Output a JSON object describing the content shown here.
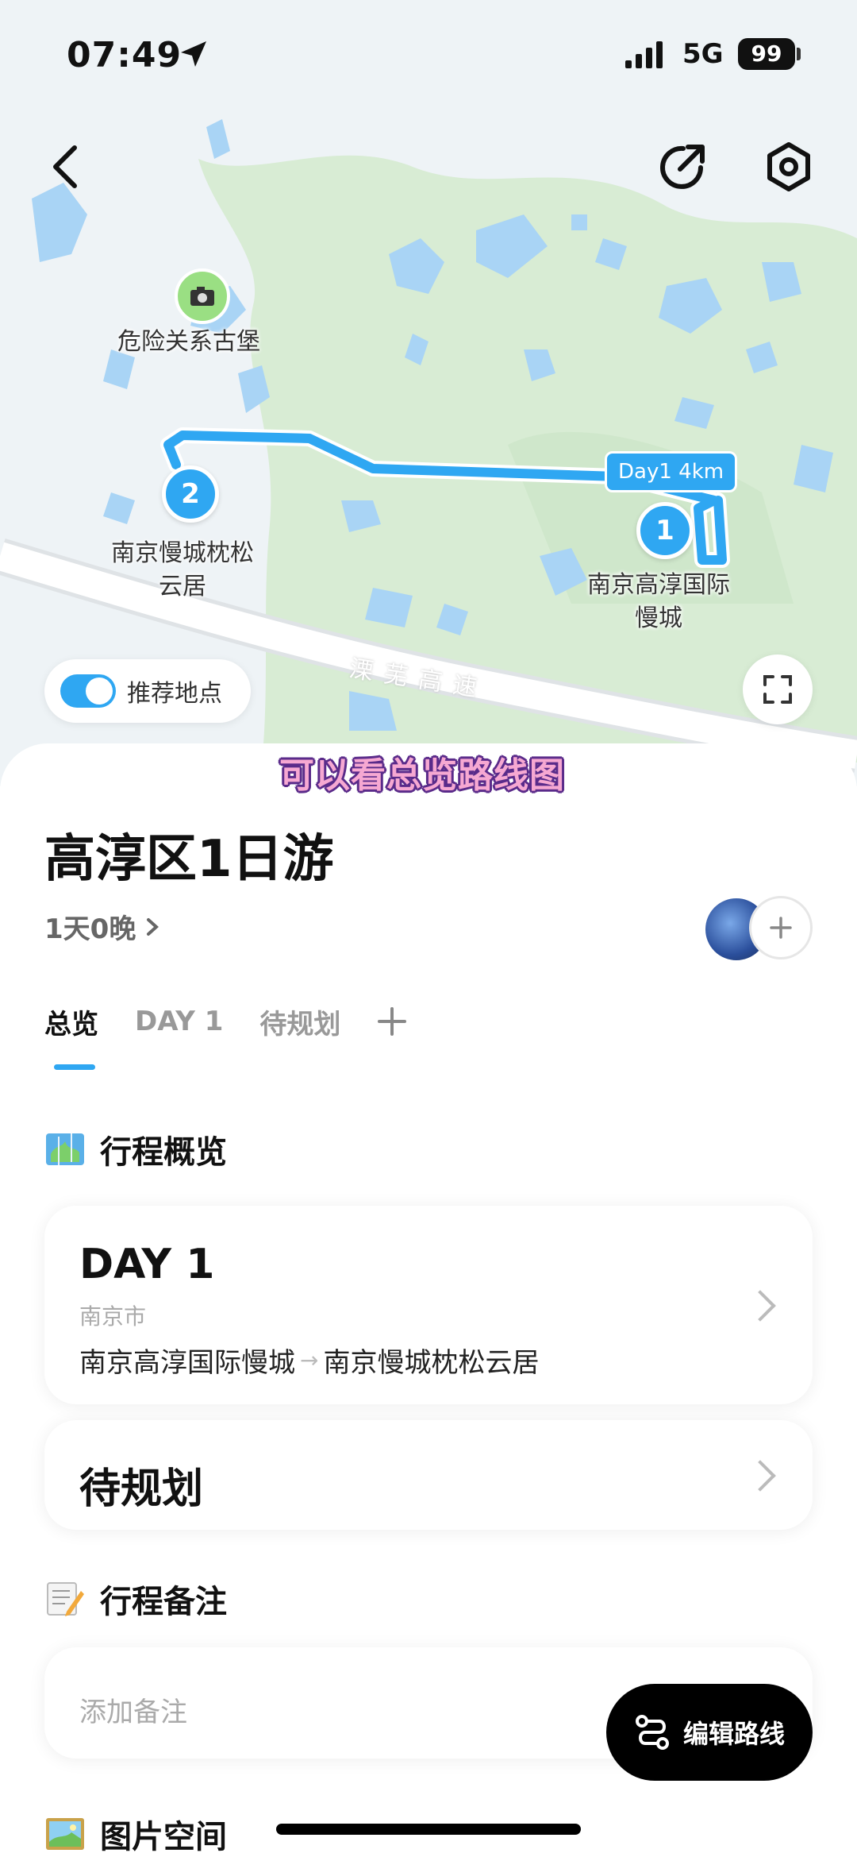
{
  "status_bar": {
    "time": "07:49",
    "network": "5G",
    "battery": "99"
  },
  "map": {
    "poi": {
      "label": "危险关系古堡",
      "icon": "camera-icon"
    },
    "stops": [
      {
        "number": "1",
        "name_line1": "南京高淳国际",
        "name_line2": "慢城"
      },
      {
        "number": "2",
        "name_line1": "南京慢城枕松",
        "name_line2": "云居"
      }
    ],
    "route_badge": "Day1 4km",
    "highway": "溧芜高速",
    "recommend_label": "推荐地点",
    "recommend_enabled": true,
    "colors": {
      "route": "#2fa7f2",
      "green_area": "#d8ecd4",
      "water": "#a9d4f5",
      "road": "#ffffff"
    }
  },
  "caption": "可以看总览路线图",
  "trip": {
    "title": "高淳区1日游",
    "duration": "1天0晚"
  },
  "tabs": [
    {
      "label": "总览",
      "active": true
    },
    {
      "label": "DAY 1",
      "active": false
    },
    {
      "label": "待规划",
      "active": false
    }
  ],
  "sections": {
    "overview": {
      "title": "行程概览",
      "icon": "map-icon"
    },
    "notes": {
      "title": "行程备注",
      "icon": "memo-icon",
      "placeholder": "添加备注"
    },
    "photos": {
      "title": "图片空间",
      "icon": "picture-icon"
    }
  },
  "day_card": {
    "title": "DAY 1",
    "city": "南京市",
    "from": "南京高淳国际慢城",
    "to": "南京慢城枕松云居"
  },
  "pending_card": {
    "title": "待规划"
  },
  "edit_route_label": "编辑路线"
}
